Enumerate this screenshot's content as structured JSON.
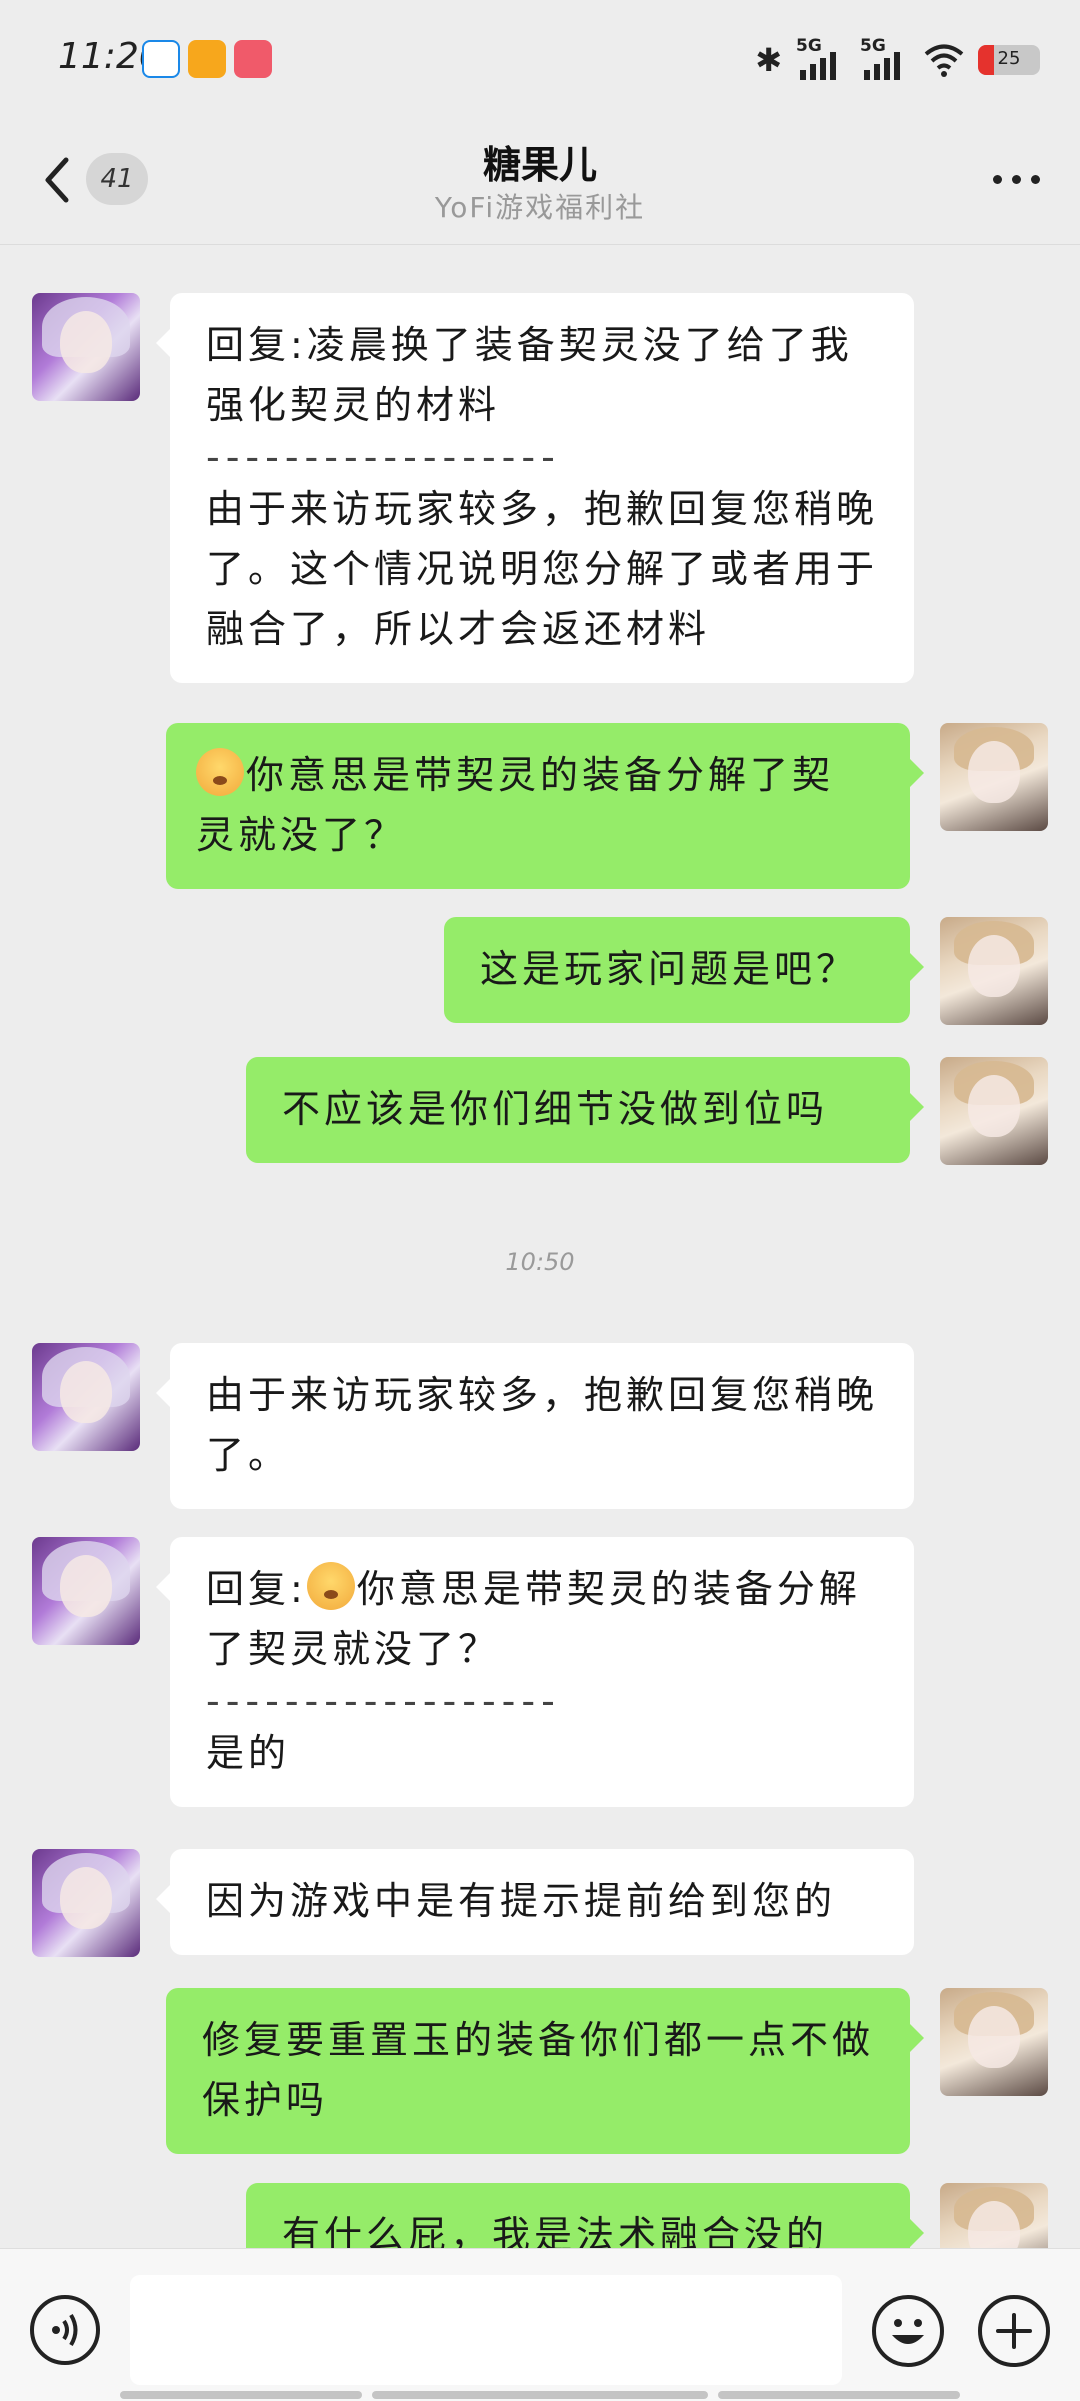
{
  "status_bar": {
    "time": "11:20",
    "network_1": "5G",
    "network_2": "5G",
    "battery": "25",
    "battery_level": 0.25
  },
  "header": {
    "unread_count": "41",
    "title": "糖果儿",
    "subtitle": "YoFi游戏福利社"
  },
  "messages": [
    {
      "side": "left",
      "quote": "回复:凌晨换了装备契灵没了给了我强化契灵的材料",
      "divider": "------------------",
      "text": "由于来访玩家较多，抱歉回复您稍晚了。这个情况说明您分解了或者用于融合了，所以才会返还材料"
    },
    {
      "side": "right",
      "emoji": "face-emoji",
      "text": "你意思是带契灵的装备分解了契灵就没了？"
    },
    {
      "side": "right",
      "text": "这是玩家问题是吧？"
    },
    {
      "side": "right",
      "text": "不应该是你们细节没做到位吗"
    },
    {
      "time": "10:50"
    },
    {
      "side": "left",
      "text": "由于来访玩家较多，抱歉回复您稍晚了。"
    },
    {
      "side": "left",
      "quote_prefix": "回复:",
      "emoji": "face-emoji",
      "quote": "你意思是带契灵的装备分解了契灵就没了？",
      "divider": "------------------",
      "text": "是的"
    },
    {
      "side": "left",
      "text": "因为游戏中是有提示提前给到您的"
    },
    {
      "side": "right",
      "text": "修复要重置玉的装备你们都一点不做保护吗"
    },
    {
      "side": "right",
      "text": "有什么屁，我是法术融合没的"
    }
  ],
  "input": {
    "placeholder": ""
  },
  "colors": {
    "sent_bubble": "#95ec69",
    "received_bubble": "#ffffff",
    "background": "#ededed"
  }
}
